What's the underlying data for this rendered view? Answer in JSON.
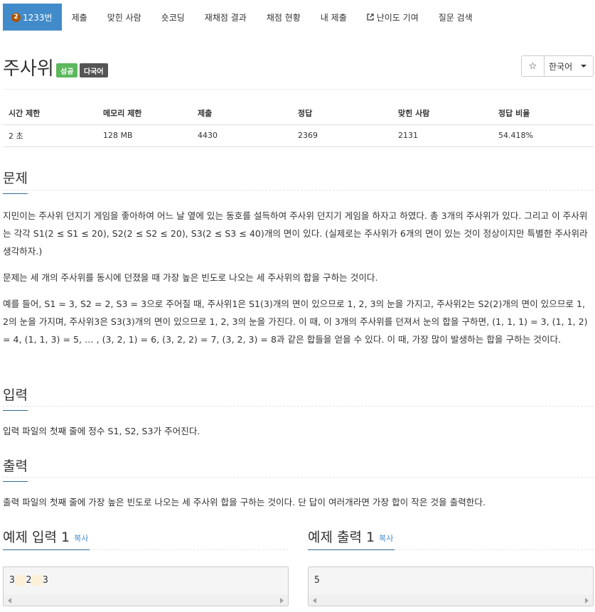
{
  "nav": {
    "problem": {
      "badge": "2",
      "label": "1233번"
    },
    "items": [
      "제출",
      "맞힌 사람",
      "숏코딩",
      "재채점 결과",
      "채점 현황",
      "내 제출",
      "난이도 기여",
      "질문 검색"
    ]
  },
  "title": "주사위",
  "labels": {
    "success": "성공",
    "multilang": "다국어"
  },
  "buttons": {
    "star": "☆",
    "lang": "한국어"
  },
  "info": {
    "headers": [
      "시간 제한",
      "메모리 제한",
      "제출",
      "정답",
      "맞힌 사람",
      "정답 비율"
    ],
    "values": [
      "2 초",
      "128 MB",
      "4430",
      "2369",
      "2131",
      "54.418%"
    ]
  },
  "sections": {
    "problem": "문제",
    "input": "입력",
    "output": "출력"
  },
  "problem_text": {
    "p1": "지민이는 주사위 던지기 게임을 좋아하여 어느 날 옆에 있는 동호를 설득하여 주사위 던지기 게임을 하자고 하였다. 총 3개의 주사위가 있다. 그리고 이 주사위는 각각 S1(2 ≤ S1 ≤ 20), S2(2 ≤ S2 ≤ 20), S3(2 ≤ S3 ≤ 40)개의 면이 있다. (실제로는 주사위가 6개의 면이 있는 것이 정상이지만 특별한 주사위라 생각하자.)",
    "p2": "문제는 세 개의 주사위를 동시에 던졌을 때 가장 높은 빈도로 나오는 세 주사위의 합을 구하는 것이다.",
    "p3": "예를 들어, S1 = 3, S2 = 2, S3 = 3으로 주어질 때, 주사위1은 S1(3)개의 면이 있으므로 1, 2, 3의 눈을 가지고, 주사위2는 S2(2)개의 면이 있으므로 1, 2의 눈을 가지며, 주사위3은 S3(3)개의 면이 있으므로 1, 2, 3의 눈을 가진다. 이 때, 이 3개의 주사위를 던져서 눈의 합을 구하면, (1, 1, 1) = 3, (1, 1, 2) = 4, (1, 1, 3) = 5, … , (3, 2, 1) = 6, (3, 2, 2) = 7, (3, 2, 3) = 8과 같은 합들을 얻을 수 있다. 이 때, 가장 많이 발생하는 합을 구하는 것이다."
  },
  "input_text": "입력 파일의 첫째 줄에 정수 S1, S2, S3가 주어진다.",
  "output_text": "출력 파일의 첫째 줄에 가장 높은 빈도로 나오는 세 주사위 합을 구하는 것이다. 단 답이 여러개라면 가장 합이 작은 것을 출력한다.",
  "samples": {
    "input_title": "예제 입력 1",
    "output_title": "예제 출력 1",
    "copy": "복사",
    "input_tokens": [
      "3",
      "2",
      "3"
    ],
    "output": "5"
  },
  "colors": {
    "primary": "#428bca",
    "success": "#5cb85c",
    "dark_label": "#555555"
  }
}
